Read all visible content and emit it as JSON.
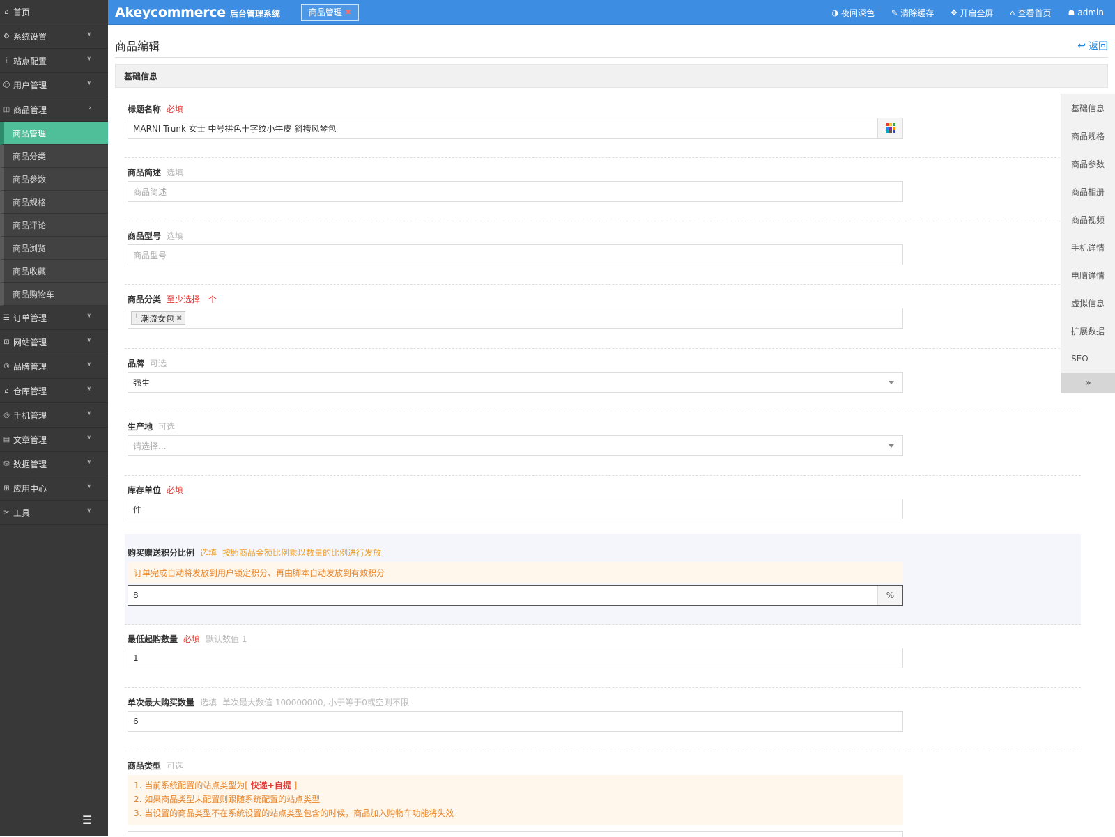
{
  "app": {
    "brand": "Akeycommerce",
    "brand_sub": "后台管理系统"
  },
  "header": {
    "tab_label": "商品管理",
    "tools": [
      "夜间深色",
      "清除缓存",
      "开启全屏",
      "查看首页",
      "admin"
    ]
  },
  "sidebar": {
    "home": "首页",
    "top_items": [
      "系统设置",
      "站点配置",
      "用户管理",
      "商品管理"
    ],
    "sub_items": [
      "商品管理",
      "商品分类",
      "商品参数",
      "商品规格",
      "商品评论",
      "商品浏览",
      "商品收藏",
      "商品购物车"
    ],
    "bottom_items": [
      "订单管理",
      "网站管理",
      "品牌管理",
      "仓库管理",
      "手机管理",
      "文章管理",
      "数据管理",
      "应用中心",
      "工具"
    ]
  },
  "page": {
    "title": "商品编辑",
    "back": "返回",
    "section": "基础信息"
  },
  "form": {
    "title": {
      "label": "标题名称",
      "tag": "必填",
      "value": "MARNI Trunk 女士 中号拼色十字纹小牛皮 斜挎风琴包"
    },
    "brief": {
      "label": "商品简述",
      "tag": "选填",
      "placeholder": "商品简述"
    },
    "model": {
      "label": "商品型号",
      "tag": "选填",
      "placeholder": "商品型号"
    },
    "category": {
      "label": "商品分类",
      "tag": "至少选择一个",
      "chip": "潮流女包"
    },
    "brand": {
      "label": "品牌",
      "tag": "可选",
      "value": "强生"
    },
    "origin": {
      "label": "生产地",
      "tag": "可选",
      "placeholder": "请选择..."
    },
    "unit": {
      "label": "库存单位",
      "tag": "必填",
      "value": "件"
    },
    "points": {
      "label": "购买赠送积分比例",
      "tag": "选填",
      "hint": "按照商品金额比例乘以数量的比例进行发放",
      "notice": "订单完成自动将发放到用户锁定积分、再由脚本自动发放到有效积分",
      "value": "8",
      "unit": "%"
    },
    "min_qty": {
      "label": "最低起购数量",
      "tag": "必填",
      "hint": "默认数值 1",
      "value": "1"
    },
    "max_qty": {
      "label": "单次最大购买数量",
      "tag": "选填",
      "hint": "单次最大数值 100000000, 小于等于0或空则不限",
      "value": "6"
    },
    "type": {
      "label": "商品类型",
      "tag": "可选",
      "notes": [
        "1. 当前系统配置的站点类型为[",
        "快递+自提",
        "]",
        "2. 如果商品类型未配置则跟随系统配置的站点类型",
        "3. 当设置的商品类型不在系统设置的站点类型包含的时候，商品加入购物车功能将失效"
      ]
    }
  },
  "float_nav": [
    "基础信息",
    "商品规格",
    "商品参数",
    "商品相册",
    "商品视频",
    "手机详情",
    "电脑详情",
    "虚拟信息",
    "扩展数据",
    "SEO"
  ],
  "colors": {
    "header": "#3d8de2",
    "sidebar": "#383838",
    "active": "#4ebf99",
    "required": "#e53935",
    "warning": "#f0a02a"
  }
}
